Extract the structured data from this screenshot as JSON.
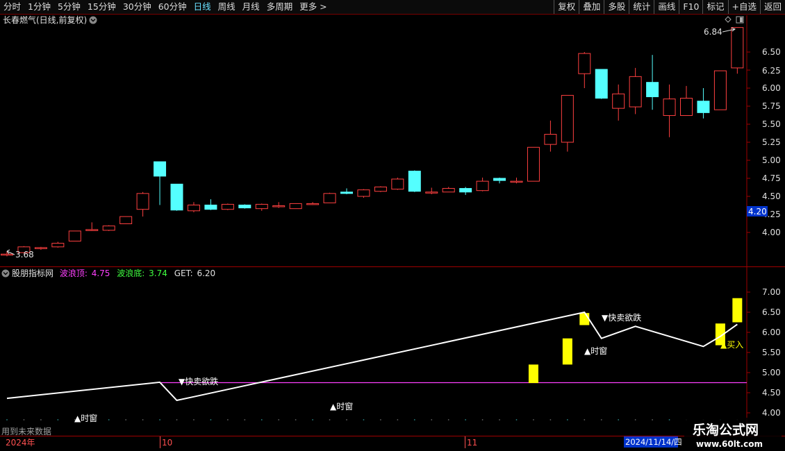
{
  "toolbar": {
    "period_tabs": [
      "分时",
      "1分钟",
      "5分钟",
      "15分钟",
      "30分钟",
      "60分钟",
      "日线",
      "周线",
      "月线",
      "多周期",
      "更多 >"
    ],
    "active_tab": "日线",
    "tools": [
      "复权",
      "叠加",
      "多股",
      "统计",
      "画线",
      "F10",
      "标记",
      "+自选",
      "返回"
    ]
  },
  "main_chart": {
    "title": "长春燃气(日线,前复权)",
    "high_label": "6.84",
    "low_label": "3.68",
    "current_price_label": "4.20",
    "yticks": [
      "6.50",
      "6.25",
      "6.00",
      "5.75",
      "5.50",
      "5.25",
      "5.00",
      "4.75",
      "4.50",
      "4.25",
      "4.00"
    ]
  },
  "indicator": {
    "name": "股朋指标网",
    "wave_top_label": "波浪顶:",
    "wave_top_value": "4.75",
    "wave_bottom_label": "波浪底:",
    "wave_bottom_value": "3.74",
    "get_label": "GET:",
    "get_value": "6.20",
    "yticks": [
      "7.00",
      "6.50",
      "6.00",
      "5.50",
      "5.00",
      "4.50",
      "4.00"
    ],
    "annotations": {
      "sell1": "▼快卖欲跌",
      "sell2": "▼快卖欲跌",
      "time1": "▲时窗",
      "time2": "▲时窗",
      "time3": "▲时窗",
      "buy": "▲买入"
    },
    "future_notice": "用到未来数据"
  },
  "timeline": {
    "year": "2024年",
    "month_oct": "10",
    "month_nov": "11",
    "cursor_date": "2024/11/14/四"
  },
  "watermark": {
    "line1": "乐淘公式网",
    "line2": "www.60lt.com"
  },
  "colors": {
    "up": "#ff4040",
    "down": "#54ffff",
    "signal": "#ffff00",
    "wave_line": "#ffffff",
    "wave_top_line": "#ff40ff",
    "axis": "#b00000"
  },
  "chart_data": {
    "type": "candlestick",
    "y_axis": {
      "min": 3.68,
      "max": 6.84
    },
    "candles": [
      {
        "o": 3.7,
        "h": 3.74,
        "l": 3.67,
        "c": 3.7
      },
      {
        "o": 3.72,
        "h": 3.81,
        "l": 3.71,
        "c": 3.8
      },
      {
        "o": 3.78,
        "h": 3.8,
        "l": 3.76,
        "c": 3.79
      },
      {
        "o": 3.8,
        "h": 3.87,
        "l": 3.79,
        "c": 3.85
      },
      {
        "o": 3.88,
        "h": 4.02,
        "l": 3.88,
        "c": 4.02
      },
      {
        "o": 4.04,
        "h": 4.14,
        "l": 4.02,
        "c": 4.04
      },
      {
        "o": 4.03,
        "h": 4.1,
        "l": 4.02,
        "c": 4.09
      },
      {
        "o": 4.12,
        "h": 4.22,
        "l": 4.12,
        "c": 4.22
      },
      {
        "o": 4.32,
        "h": 4.56,
        "l": 4.22,
        "c": 4.54
      },
      {
        "o": 4.98,
        "h": 4.98,
        "l": 4.38,
        "c": 4.78
      },
      {
        "o": 4.67,
        "h": 4.67,
        "l": 4.3,
        "c": 4.31
      },
      {
        "o": 4.3,
        "h": 4.42,
        "l": 4.28,
        "c": 4.38
      },
      {
        "o": 4.38,
        "h": 4.46,
        "l": 4.31,
        "c": 4.32
      },
      {
        "o": 4.32,
        "h": 4.4,
        "l": 4.31,
        "c": 4.39
      },
      {
        "o": 4.38,
        "h": 4.39,
        "l": 4.33,
        "c": 4.34
      },
      {
        "o": 4.33,
        "h": 4.4,
        "l": 4.3,
        "c": 4.39
      },
      {
        "o": 4.37,
        "h": 4.42,
        "l": 4.34,
        "c": 4.37
      },
      {
        "o": 4.33,
        "h": 4.4,
        "l": 4.33,
        "c": 4.4
      },
      {
        "o": 4.4,
        "h": 4.42,
        "l": 4.38,
        "c": 4.4
      },
      {
        "o": 4.41,
        "h": 4.55,
        "l": 4.41,
        "c": 4.54
      },
      {
        "o": 4.56,
        "h": 4.61,
        "l": 4.53,
        "c": 4.54
      },
      {
        "o": 4.5,
        "h": 4.6,
        "l": 4.48,
        "c": 4.59
      },
      {
        "o": 4.57,
        "h": 4.64,
        "l": 4.56,
        "c": 4.63
      },
      {
        "o": 4.6,
        "h": 4.76,
        "l": 4.59,
        "c": 4.74
      },
      {
        "o": 4.85,
        "h": 4.86,
        "l": 4.56,
        "c": 4.57
      },
      {
        "o": 4.55,
        "h": 4.62,
        "l": 4.53,
        "c": 4.56
      },
      {
        "o": 4.56,
        "h": 4.63,
        "l": 4.56,
        "c": 4.61
      },
      {
        "o": 4.61,
        "h": 4.63,
        "l": 4.52,
        "c": 4.56
      },
      {
        "o": 4.58,
        "h": 4.76,
        "l": 4.57,
        "c": 4.71
      },
      {
        "o": 4.75,
        "h": 4.76,
        "l": 4.68,
        "c": 4.72
      },
      {
        "o": 4.71,
        "h": 4.76,
        "l": 4.68,
        "c": 4.71
      },
      {
        "o": 4.71,
        "h": 5.18,
        "l": 4.71,
        "c": 5.18
      },
      {
        "o": 5.22,
        "h": 5.55,
        "l": 5.12,
        "c": 5.36
      },
      {
        "o": 5.25,
        "h": 5.9,
        "l": 5.12,
        "c": 5.9
      },
      {
        "o": 6.2,
        "h": 6.5,
        "l": 6.0,
        "c": 6.48
      },
      {
        "o": 6.26,
        "h": 6.26,
        "l": 5.85,
        "c": 5.86
      },
      {
        "o": 5.72,
        "h": 6.05,
        "l": 5.55,
        "c": 5.92
      },
      {
        "o": 5.74,
        "h": 6.28,
        "l": 5.64,
        "c": 6.16
      },
      {
        "o": 6.08,
        "h": 6.46,
        "l": 5.7,
        "c": 5.88
      },
      {
        "o": 5.62,
        "h": 6.05,
        "l": 5.32,
        "c": 5.85
      },
      {
        "o": 5.62,
        "h": 6.03,
        "l": 5.62,
        "c": 5.86
      },
      {
        "o": 5.82,
        "h": 6.0,
        "l": 5.58,
        "c": 5.66
      },
      {
        "o": 5.7,
        "h": 6.24,
        "l": 5.7,
        "c": 6.24
      },
      {
        "o": 6.28,
        "h": 6.84,
        "l": 6.2,
        "c": 6.84
      }
    ],
    "indicator": {
      "y_axis": {
        "min": 4.0,
        "max": 7.0
      },
      "wave_top": 4.75,
      "wave_points": [
        {
          "i": 0,
          "v": 4.36
        },
        {
          "i": 9,
          "v": 4.76
        },
        {
          "i": 10,
          "v": 4.31
        },
        {
          "i": 11,
          "v": 4.4
        },
        {
          "i": 34,
          "v": 6.5
        },
        {
          "i": 35,
          "v": 5.85
        },
        {
          "i": 37,
          "v": 6.15
        },
        {
          "i": 41,
          "v": 5.65
        },
        {
          "i": 42,
          "v": 5.9
        },
        {
          "i": 43,
          "v": 6.2
        }
      ],
      "signal_bars": [
        {
          "i": 31,
          "low": 4.74,
          "high": 5.2
        },
        {
          "i": 33,
          "low": 5.2,
          "high": 5.85
        },
        {
          "i": 34,
          "low": 6.18,
          "high": 6.48
        },
        {
          "i": 42,
          "low": 5.68,
          "high": 6.22
        },
        {
          "i": 43,
          "low": 6.25,
          "high": 6.85
        }
      ]
    }
  }
}
